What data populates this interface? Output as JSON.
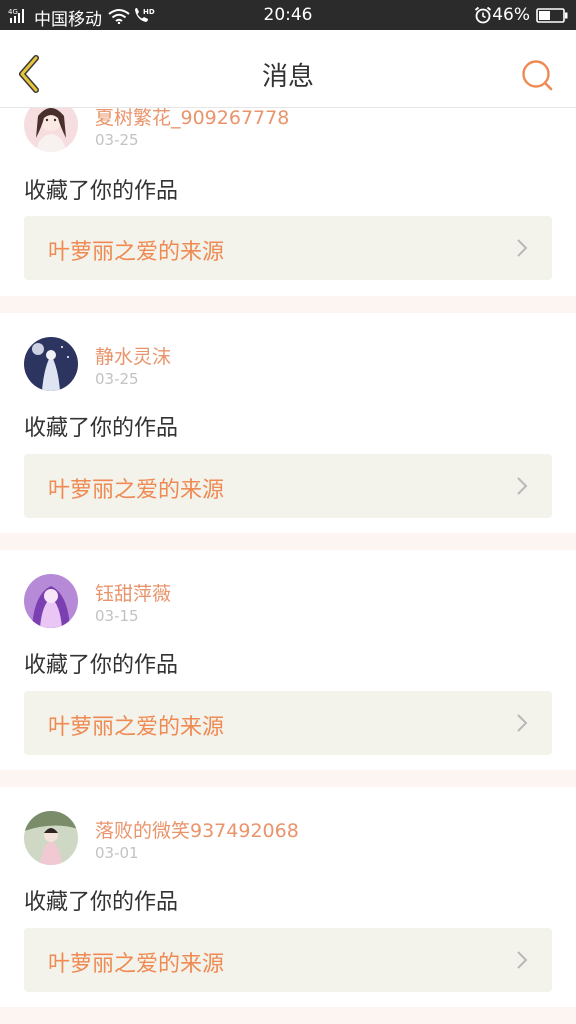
{
  "status_bar": {
    "carrier": "中国移动",
    "network_badge": "4G",
    "hd_badge": "HD",
    "time": "20:46",
    "battery": "46%",
    "icons": [
      "signal-icon",
      "wifi-icon",
      "hd-call-icon",
      "alarm-icon",
      "battery-icon"
    ]
  },
  "header": {
    "title": "消息",
    "back_icon": "chevron-left-icon",
    "search_icon": "search-icon"
  },
  "messages": [
    {
      "username": "夏树繁花_909267778",
      "date": "03-25",
      "action": "收藏了你的作品",
      "work_title": "叶萝丽之爱的来源"
    },
    {
      "username": "静水灵沫",
      "date": "03-25",
      "action": "收藏了你的作品",
      "work_title": "叶萝丽之爱的来源"
    },
    {
      "username": "钰甜萍薇",
      "date": "03-15",
      "action": "收藏了你的作品",
      "work_title": "叶萝丽之爱的来源"
    },
    {
      "username": "落败的微笑937492068",
      "date": "03-01",
      "action": "收藏了你的作品",
      "work_title": "叶萝丽之爱的来源"
    }
  ],
  "colors": {
    "accent": "#ee8a52",
    "username": "#e9946b",
    "back_icon": "#e8b23a",
    "separator": "#fdf5f2",
    "work_card_bg": "#f3f3ec"
  }
}
